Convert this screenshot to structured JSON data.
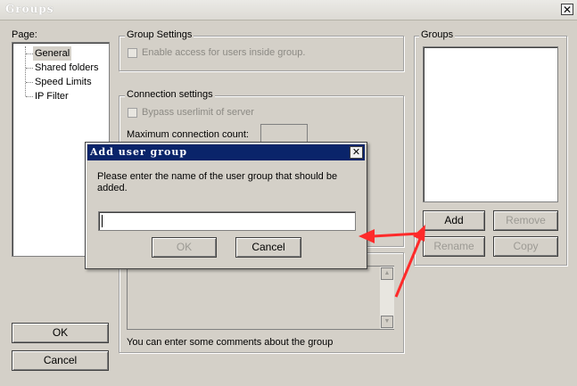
{
  "window": {
    "title": "Groups"
  },
  "page_panel": {
    "label": "Page:",
    "items": [
      "General",
      "Shared folders",
      "Speed Limits",
      "IP Filter"
    ],
    "selected": "General"
  },
  "group_settings": {
    "legend": "Group Settings",
    "enable_access_label": "Enable access for users inside group."
  },
  "connection_settings": {
    "legend": "Connection settings",
    "bypass_label": "Bypass userlimit of server",
    "max_conn_label": "Maximum connection count:"
  },
  "comments": {
    "hint": "You can enter some comments about the group"
  },
  "groups_panel": {
    "legend": "Groups",
    "add_label": "Add",
    "remove_label": "Remove",
    "rename_label": "Rename",
    "copy_label": "Copy"
  },
  "footer": {
    "ok_label": "OK",
    "cancel_label": "Cancel"
  },
  "dialog": {
    "title": "Add user group",
    "prompt": "Please enter the name of the user group that should be added.",
    "input_value": "",
    "ok_label": "OK",
    "cancel_label": "Cancel"
  },
  "close_glyph": "✕",
  "colors": {
    "dialog_title_bg": "#0a246a",
    "arrow": "#ff2a2a",
    "selection_bg": "#d4d0c8"
  }
}
